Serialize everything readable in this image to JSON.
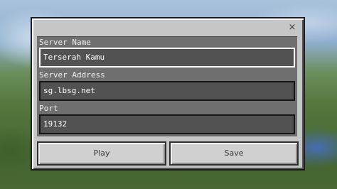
{
  "dialog": {
    "close_glyph": "×",
    "fields": [
      {
        "label": "Server Name",
        "value": "Terserah Kamu"
      },
      {
        "label": "Server Address",
        "value": "sg.lbsg.net"
      },
      {
        "label": "Port",
        "value": "19132"
      }
    ],
    "buttons": {
      "play": "Play",
      "save": "Save"
    }
  },
  "icons": {
    "close": "close-icon"
  },
  "colors": {
    "dialog_bg": "#c6c6c6",
    "panel_bg": "#6f6f6f",
    "field_bg": "#525252",
    "active_field_border": "#ffffff",
    "button_bg": "#d0d0d0"
  }
}
